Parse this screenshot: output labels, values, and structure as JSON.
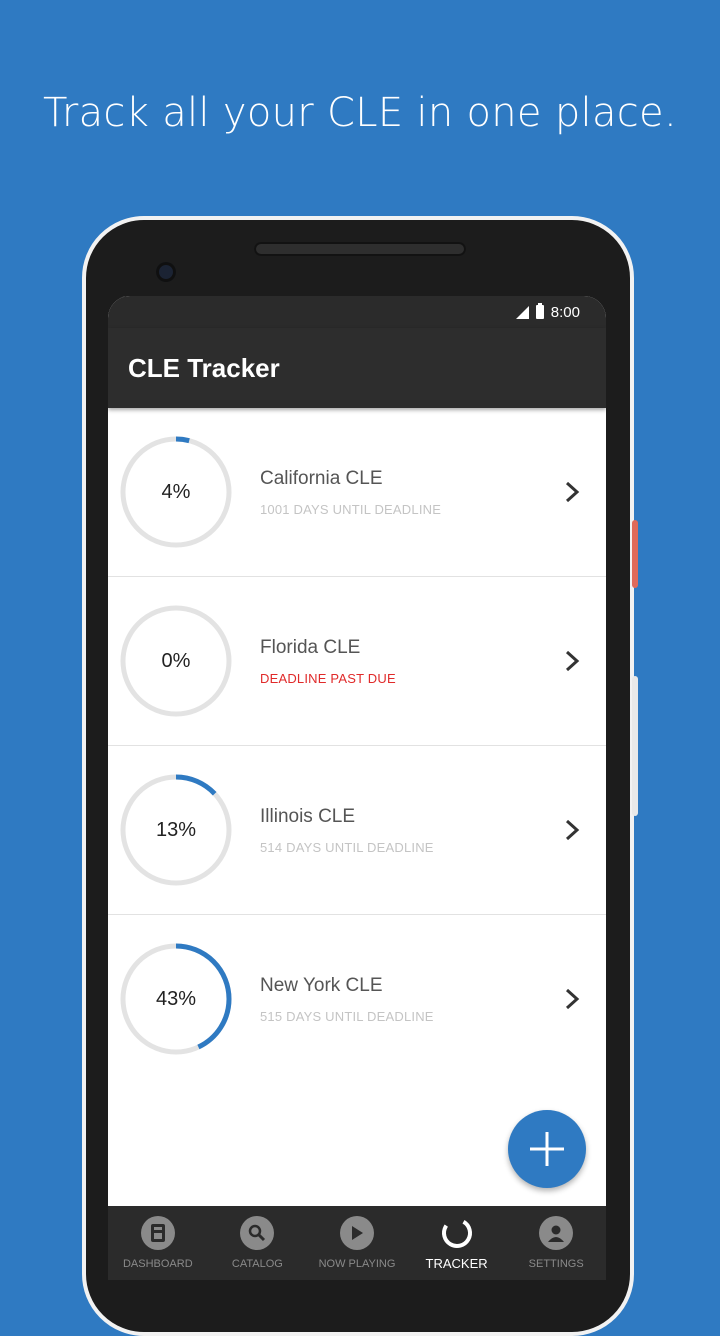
{
  "headline": "Track all your CLE in one place.",
  "status_bar": {
    "time": "8:00"
  },
  "app_bar": {
    "title": "CLE Tracker"
  },
  "colors": {
    "accent": "#2f7ac2",
    "alert": "#e02a2a",
    "ring_track": "#e3e3e3"
  },
  "trackers": [
    {
      "percent": 4,
      "percent_label": "4%",
      "title": "California CLE",
      "subtitle": "1001 DAYS UNTIL DEADLINE",
      "alert": false
    },
    {
      "percent": 0,
      "percent_label": "0%",
      "title": "Florida CLE",
      "subtitle": "DEADLINE PAST DUE",
      "alert": true
    },
    {
      "percent": 13,
      "percent_label": "13%",
      "title": "Illinois CLE",
      "subtitle": "514 DAYS UNTIL DEADLINE",
      "alert": false
    },
    {
      "percent": 43,
      "percent_label": "43%",
      "title": "New York CLE",
      "subtitle": "515 DAYS UNTIL DEADLINE",
      "alert": false
    }
  ],
  "fab": {
    "icon": "plus-icon"
  },
  "bottom_nav": [
    {
      "label": "DASHBOARD",
      "icon": "dashboard-icon",
      "active": false
    },
    {
      "label": "CATALOG",
      "icon": "search-icon",
      "active": false
    },
    {
      "label": "NOW PLAYING",
      "icon": "play-icon",
      "active": false
    },
    {
      "label": "TRACKER",
      "icon": "tracker-ring-icon",
      "active": true
    },
    {
      "label": "SETTINGS",
      "icon": "person-icon",
      "active": false
    }
  ]
}
